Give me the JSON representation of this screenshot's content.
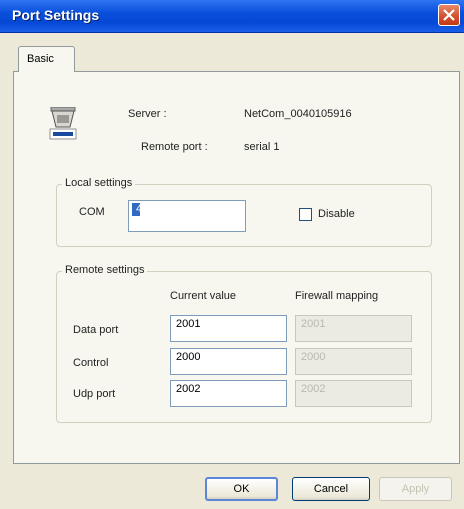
{
  "window": {
    "title": "Port Settings"
  },
  "tabs": [
    {
      "label": "Basic",
      "selected": true
    }
  ],
  "info": {
    "icon": "serial-device-icon",
    "server_label": "Server :",
    "server_value": "NetCom_0040105916",
    "remote_port_label": "Remote port :",
    "remote_port_value": "serial 1"
  },
  "local_settings": {
    "title": "Local settings",
    "com_label": "COM",
    "com_value": "4",
    "disable_label": "Disable",
    "disable_checked": false
  },
  "remote_settings": {
    "title": "Remote settings",
    "col_current": "Current value",
    "col_firewall": "Firewall mapping",
    "rows": [
      {
        "label": "Data port",
        "current": "2001",
        "firewall": "2001"
      },
      {
        "label": "Control",
        "current": "2000",
        "firewall": "2000"
      },
      {
        "label": "Udp port",
        "current": "2002",
        "firewall": "2002"
      }
    ]
  },
  "buttons": {
    "ok": "OK",
    "cancel": "Cancel",
    "apply": "Apply"
  }
}
